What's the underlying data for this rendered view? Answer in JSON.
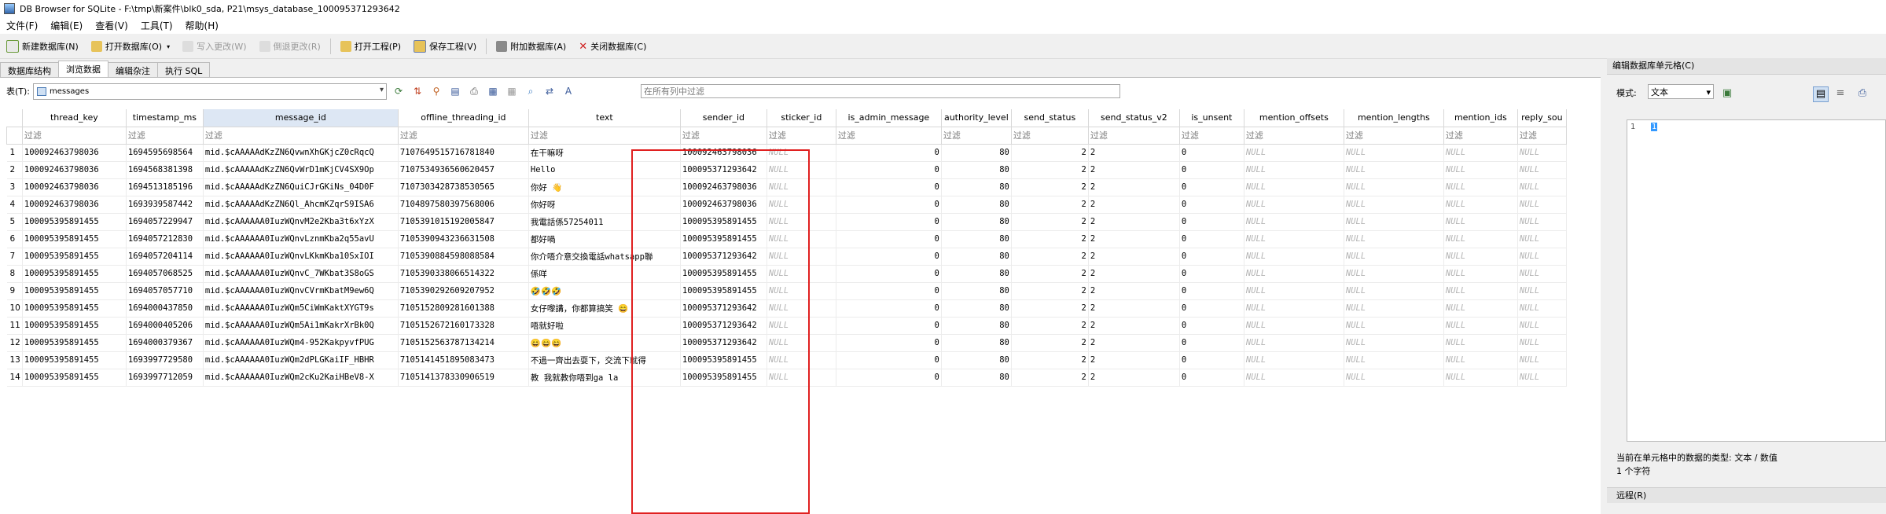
{
  "window": {
    "title": "DB Browser for SQLite - F:\\tmp\\新案件\\blk0_sda, P21\\msys_database_100095371293642"
  },
  "menu": [
    "文件(F)",
    "编辑(E)",
    "查看(V)",
    "工具(T)",
    "帮助(H)"
  ],
  "toolbar": {
    "new_db": "新建数据库(N)",
    "open_db": "打开数据库(O)",
    "write_changes": "写入更改(W)",
    "revert_changes": "倒退更改(R)",
    "open_project": "打开工程(P)",
    "save_project": "保存工程(V)",
    "attach_db": "附加数据库(A)",
    "close_db": "关闭数据库(C)"
  },
  "tabs": [
    "数据库结构",
    "浏览数据",
    "编辑杂注",
    "执行 SQL"
  ],
  "browse": {
    "table_label": "表(T):",
    "table_name": "messages",
    "filter_all_placeholder": "在所有列中过滤",
    "filter_placeholder": "过滤",
    "columns": [
      "thread_key",
      "timestamp_ms",
      "message_id",
      "offline_threading_id",
      "text",
      "sender_id",
      "sticker_id",
      "is_admin_message",
      "authority_level",
      "send_status",
      "send_status_v2",
      "is_unsent",
      "mention_offsets",
      "mention_lengths",
      "mention_ids",
      "reply_sou"
    ],
    "rows": [
      [
        "1",
        "100092463798036",
        "1694595698564",
        "mid.$cAAAAAdKzZN6QvwnXhGKjcZ0cRqcQ",
        "7107649515716781840",
        "在干嘛呀",
        "100092463798036",
        "NULL",
        "0",
        "80",
        "2",
        "2",
        "0",
        "NULL",
        "NULL",
        "NULL",
        "NULL"
      ],
      [
        "2",
        "100092463798036",
        "1694568381398",
        "mid.$cAAAAAdKzZN6QvWrD1mKjCV4SX9Op",
        "7107534936560620457",
        "Hello",
        "100095371293642",
        "NULL",
        "0",
        "80",
        "2",
        "2",
        "0",
        "NULL",
        "NULL",
        "NULL",
        "NULL"
      ],
      [
        "3",
        "100092463798036",
        "1694513185196",
        "mid.$cAAAAAdKzZN6QuiCJrGKiNs_04D0F",
        "7107303428738530565",
        "你好 👋",
        "100092463798036",
        "NULL",
        "0",
        "80",
        "2",
        "2",
        "0",
        "NULL",
        "NULL",
        "NULL",
        "NULL"
      ],
      [
        "4",
        "100092463798036",
        "1693939587442",
        "mid.$cAAAAAdKzZN6Ql_AhcmKZqrS9ISA6",
        "7104897580397568006",
        "你好呀",
        "100092463798036",
        "NULL",
        "0",
        "80",
        "2",
        "2",
        "0",
        "NULL",
        "NULL",
        "NULL",
        "NULL"
      ],
      [
        "5",
        "100095395891455",
        "1694057229947",
        "mid.$cAAAAAA0IuzWQnvM2e2Kba3t6xYzX",
        "7105391015192005847",
        "我電話係57254011",
        "100095395891455",
        "NULL",
        "0",
        "80",
        "2",
        "2",
        "0",
        "NULL",
        "NULL",
        "NULL",
        "NULL"
      ],
      [
        "6",
        "100095395891455",
        "1694057212830",
        "mid.$cAAAAAA0IuzWQnvLznmKba2q55avU",
        "7105390943236631508",
        "都好喎",
        "100095395891455",
        "NULL",
        "0",
        "80",
        "2",
        "2",
        "0",
        "NULL",
        "NULL",
        "NULL",
        "NULL"
      ],
      [
        "7",
        "100095395891455",
        "1694057204114",
        "mid.$cAAAAAA0IuzWQnvLKkmKba10SxIOI",
        "7105390884598088584",
        "你介唔介意交換電話whatsapp聯",
        "100095371293642",
        "NULL",
        "0",
        "80",
        "2",
        "2",
        "0",
        "NULL",
        "NULL",
        "NULL",
        "NULL"
      ],
      [
        "8",
        "100095395891455",
        "1694057068525",
        "mid.$cAAAAAA0IuzWQnvC_7WKbat3S8oGS",
        "7105390338066514322",
        "係咩",
        "100095395891455",
        "NULL",
        "0",
        "80",
        "2",
        "2",
        "0",
        "NULL",
        "NULL",
        "NULL",
        "NULL"
      ],
      [
        "9",
        "100095395891455",
        "1694057057710",
        "mid.$cAAAAAA0IuzWQnvCVrmKbatM9ew6Q",
        "7105390292609207952",
        "🤣🤣🤣",
        "100095395891455",
        "NULL",
        "0",
        "80",
        "2",
        "2",
        "0",
        "NULL",
        "NULL",
        "NULL",
        "NULL"
      ],
      [
        "10",
        "100095395891455",
        "1694000437850",
        "mid.$cAAAAAA0IuzWQm5CiWmKaktXYGT9s",
        "7105152809281601388",
        "女仔嚟講，你都算搞笑 😄",
        "100095371293642",
        "NULL",
        "0",
        "80",
        "2",
        "2",
        "0",
        "NULL",
        "NULL",
        "NULL",
        "NULL"
      ],
      [
        "11",
        "100095395891455",
        "1694000405206",
        "mid.$cAAAAAA0IuzWQm5Ai1mKakrXrBk0Q",
        "7105152672160173328",
        "唔就好啦",
        "100095371293642",
        "NULL",
        "0",
        "80",
        "2",
        "2",
        "0",
        "NULL",
        "NULL",
        "NULL",
        "NULL"
      ],
      [
        "12",
        "100095395891455",
        "1694000379367",
        "mid.$cAAAAAA0IuzWQm4-952KakpyvfPUG",
        "7105152563787134214",
        "😄😄😄",
        "100095371293642",
        "NULL",
        "0",
        "80",
        "2",
        "2",
        "0",
        "NULL",
        "NULL",
        "NULL",
        "NULL"
      ],
      [
        "13",
        "100095395891455",
        "1693997729580",
        "mid.$cAAAAAA0IuzWQm2dPLGKaiIF_HBHR",
        "7105141451895083473",
        "不過一齊出去耍下，交流下就得",
        "100095395891455",
        "NULL",
        "0",
        "80",
        "2",
        "2",
        "0",
        "NULL",
        "NULL",
        "NULL",
        "NULL"
      ],
      [
        "14",
        "100095395891455",
        "1693997712059",
        "mid.$cAAAAAA0IuzWQm2cKu2KaiHBeV8-X",
        "7105141378330906519",
        "教 我就教你唔到ga la",
        "100095395891455",
        "NULL",
        "0",
        "80",
        "2",
        "2",
        "0",
        "NULL",
        "NULL",
        "NULL",
        "NULL"
      ]
    ]
  },
  "cell_editor": {
    "title": "编辑数据库单元格(C)",
    "mode_label": "模式:",
    "mode_value": "文本",
    "line_number": "1",
    "value": "1",
    "type_info": "当前在单元格中的数据的类型: 文本 / 数值",
    "size_info": "1 个字符",
    "remote_title": "远程(R)"
  },
  "colors": {
    "highlight": "#e02020",
    "selection": "#3399ff"
  }
}
